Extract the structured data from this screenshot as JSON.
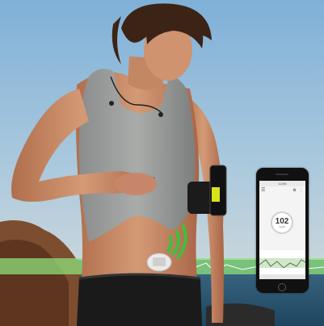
{
  "phone_app": {
    "status_time": "12:00",
    "glucose_value": "102",
    "glucose_unit": "mg/dL",
    "menu_icon": "hamburger-menu-icon",
    "event_icons": [
      "running-person-icon",
      "dots-icon"
    ]
  },
  "colors": {
    "sky": "#6f9fc9",
    "sea": "#2f5a78",
    "sensor_signal": "#3fbf3f",
    "trend_band": "#8fe07a",
    "armband_accent": "#d8e31b"
  }
}
